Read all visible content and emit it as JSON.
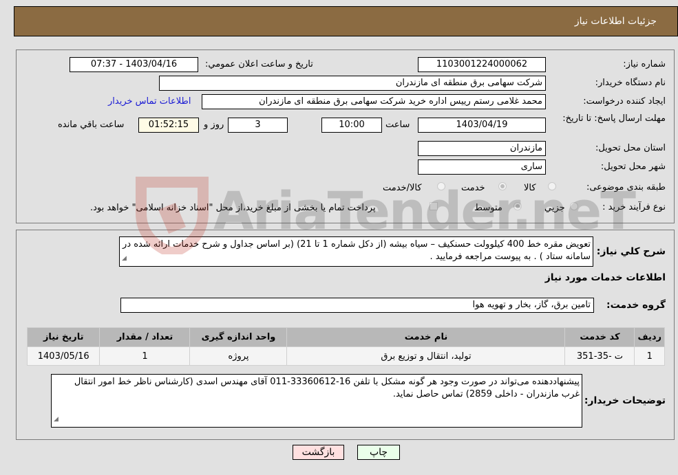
{
  "header": {
    "title": "جزئیات اطلاعات نیاز"
  },
  "form": {
    "need_number": {
      "label": "شماره نیاز:",
      "value": "1103001224000062"
    },
    "announce_datetime": {
      "label": "تاریخ و ساعت اعلان عمومي:",
      "value": "1403/04/16 - 07:37"
    },
    "buyer_org": {
      "label": "نام دستگاه خریدار:",
      "value": "شرکت سهامی برق منطقه ای مازندران"
    },
    "requester": {
      "label": "ایجاد کننده درخواست:",
      "value": "محمد غلامی رستم رییس اداره خرید شرکت سهامی برق منطقه ای مازندران"
    },
    "buyer_contact_link": "اطلاعات تماس خریدار",
    "deadline": {
      "label": "مهلت ارسال پاسخ: تا تاریخ:",
      "date": "1403/04/19",
      "time_label": "ساعت",
      "time": "10:00",
      "days": "3",
      "days_label": "روز و",
      "remaining": "01:52:15",
      "remaining_label": "ساعت باقي مانده"
    },
    "delivery_province": {
      "label": "استان محل تحویل:",
      "value": "مازندران"
    },
    "delivery_city": {
      "label": "شهر محل تحویل:",
      "value": "ساری"
    },
    "category": {
      "label": "طبقه بندی موضوعی:",
      "options": [
        "کالا",
        "خدمت",
        "کالا/خدمت"
      ],
      "selected": "خدمت"
    },
    "purchase_type": {
      "label": "نوع فرآیند خرید :",
      "options": [
        "جزیي",
        "متوسط"
      ],
      "selected": "متوسط",
      "treasury_note": "پرداخت تمام یا بخشی از مبلغ خرید،از محل \"اسناد خزانه اسلامی\" خواهد بود."
    }
  },
  "description": {
    "label": "شرح كلي نياز:",
    "value": "تعویض مقره خط 400 کیلوولت حسنکیف – سیاه بیشه (از دکل شماره 1 تا 21) (بر اساس جداول و شرح خدمات ارائه شده در سامانه ستاد ) . به پیوست مراجعه فرمایید ."
  },
  "services": {
    "section_title": "اطلاعات خدمات مورد نیاز",
    "group_label": "گروه خدمت:",
    "group_value": "تامین برق، گاز، بخار و تهویه هوا",
    "columns": [
      "ردیف",
      "کد خدمت",
      "نام خدمت",
      "واحد اندازه گیری",
      "تعداد / مقدار",
      "تاریخ نیاز"
    ],
    "rows": [
      [
        "1",
        "ت -35-351",
        "تولید، انتقال و توزیع برق",
        "پروژه",
        "1",
        "1403/05/16"
      ]
    ]
  },
  "buyer_notes": {
    "label": "توضیحات خریدار:",
    "value": "پیشنهاددهنده می‌تواند در صورت وجود هر گونه مشکل با تلفن 16-33360612-011  آقای مهندس اسدی (کارشناس ناظر خط امور انتقال غرب مازندران - داخلی 2859) تماس حاصل نماید."
  },
  "buttons": {
    "print": "چاپ",
    "back": "بازگشت"
  },
  "watermark": {
    "text": "AriaTender.neT"
  }
}
